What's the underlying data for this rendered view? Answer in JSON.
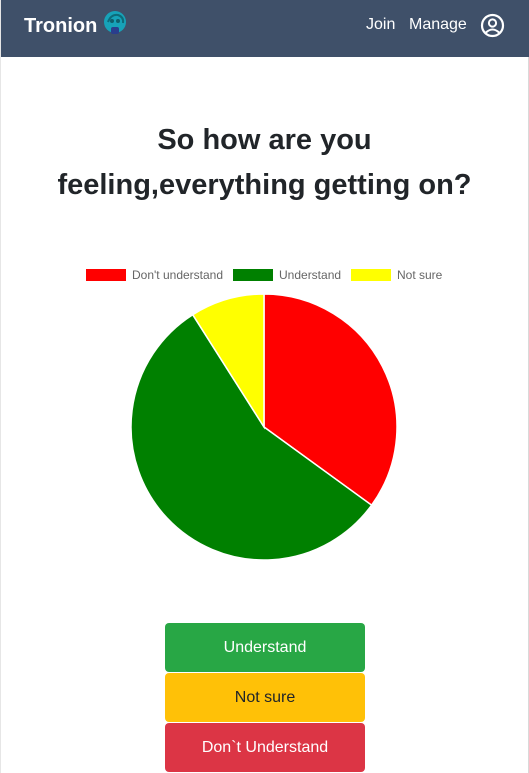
{
  "navbar": {
    "brand": "Tronion",
    "links": [
      "Join",
      "Manage"
    ]
  },
  "title": "So how are you feeling,everything getting on?",
  "chart_data": {
    "type": "pie",
    "categories": [
      "Don't understand",
      "Understand",
      "Not sure"
    ],
    "values": [
      35,
      56,
      9
    ],
    "colors": [
      "#ff0000",
      "#008000",
      "#ffff00"
    ],
    "legend_position": "top"
  },
  "buttons": {
    "understand": "Understand",
    "not_sure": "Not sure",
    "dont_understand": "Don`t Understand"
  }
}
